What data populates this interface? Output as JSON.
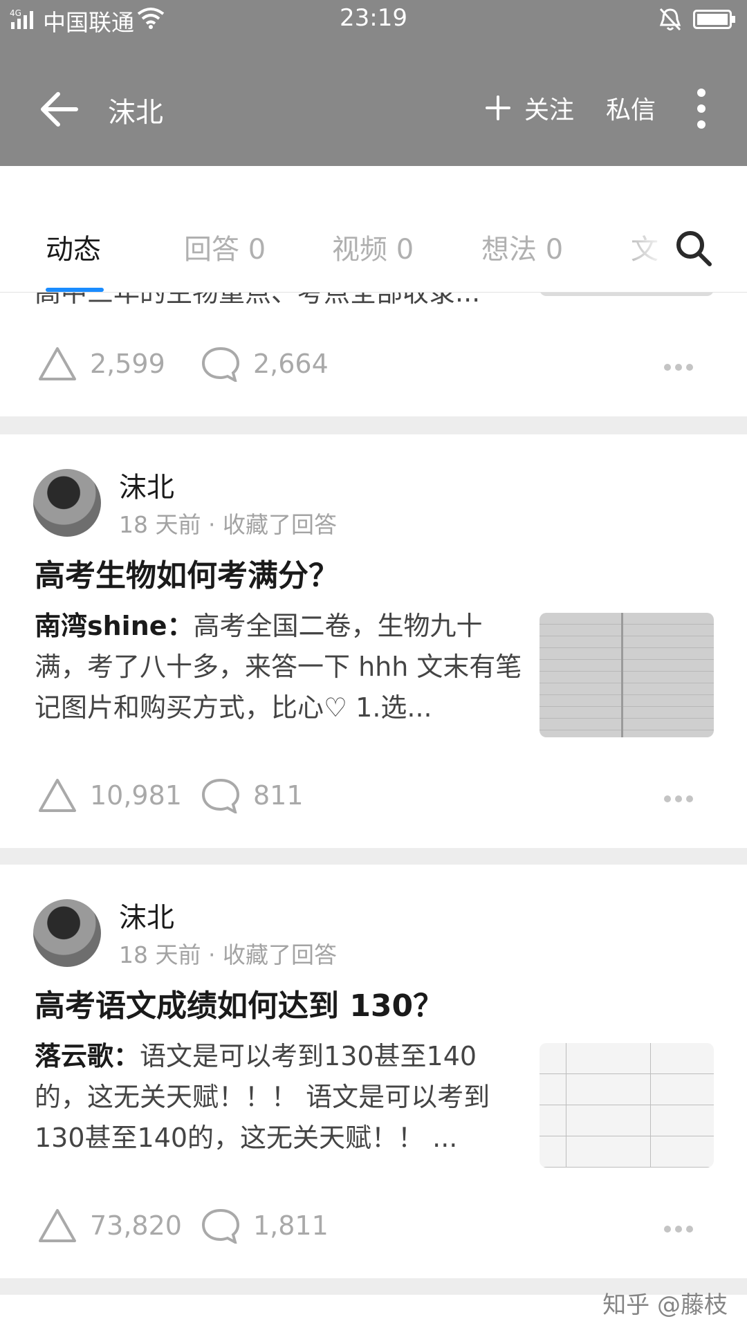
{
  "status_bar": {
    "carrier": "中国联通",
    "time": "23:19",
    "network": "4G"
  },
  "app_bar": {
    "title": "沫北",
    "follow_label": "关注",
    "message_label": "私信"
  },
  "tabs": [
    {
      "label": "动态",
      "active": true
    },
    {
      "label": "回答 0",
      "active": false
    },
    {
      "label": "视频 0",
      "active": false
    },
    {
      "label": "想法 0",
      "active": false
    },
    {
      "label": "文",
      "active": false
    }
  ],
  "partial_card": {
    "excerpt_tail": "高中三年的生物重点、考点全部收录...",
    "upvotes": "2,599",
    "comments": "2,664"
  },
  "feed": [
    {
      "author": "沫北",
      "meta": "18 天前 · 收藏了回答",
      "title": "高考生物如何考满分？",
      "answerer": "南湾shine：",
      "excerpt": "高考全国二卷，生物九十满，考了八十多，来答一下 hhh 文末有笔记图片和购买方式，比心♡ 1.选...",
      "upvotes": "10,981",
      "comments": "811"
    },
    {
      "author": "沫北",
      "meta": "18 天前 · 收藏了回答",
      "title": "高考语文成绩如何达到 130？",
      "answerer": "落云歌：",
      "excerpt": "语文是可以考到130甚至140的，这无关天赋！！！ 语文是可以考到130甚至140的，这无关天赋！！ ...",
      "upvotes": "73,820",
      "comments": "1,811"
    }
  ],
  "watermark": "知乎 @藤枝",
  "colors": {
    "app_bar": "#888888",
    "tab_indicator": "#1a8cff",
    "background": "#ededed"
  },
  "icons": [
    "back-arrow-icon",
    "plus-icon",
    "more-vertical-icon",
    "search-icon",
    "upvote-icon",
    "comment-icon",
    "more-horizontal-icon"
  ]
}
